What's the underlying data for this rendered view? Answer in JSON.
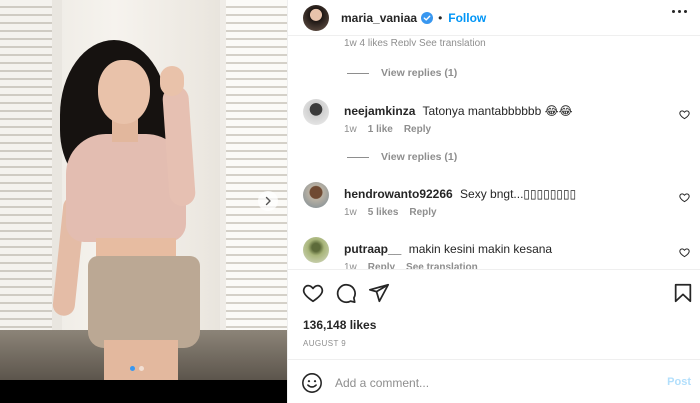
{
  "post": {
    "username": "maria_vaniaa",
    "separator": "•",
    "follow_label": "Follow",
    "carousel_dots": 2,
    "active_dot": 0
  },
  "comments": {
    "partial_line": "1w   4 likes   Reply   See translation",
    "view_replies_1": "View replies (1)",
    "view_replies_2": "View replies (1)",
    "items": [
      {
        "username": "neejamkinza",
        "text": "Tatonya mantabbbbbb 😂😂",
        "age": "1w",
        "likes": "1 like",
        "reply": "Reply"
      },
      {
        "username": "hendrowanto92266",
        "text": "Sexy bngt...▯▯▯▯▯▯▯▯",
        "age": "1w",
        "likes": "5 likes",
        "reply": "Reply"
      },
      {
        "username": "putraap__",
        "text": "makin kesini makin kesana",
        "age": "1w",
        "reply": "Reply",
        "translate": "See translation"
      }
    ]
  },
  "actions": {
    "icons": [
      "heart-icon",
      "comment-icon",
      "share-icon",
      "bookmark-icon"
    ],
    "likes_text": "136,148 likes",
    "date": "AUGUST 9"
  },
  "composer": {
    "placeholder": "Add a comment...",
    "post_label": "Post"
  },
  "colors": {
    "accent": "#0095f6",
    "post_disabled": "#b2dffc",
    "muted": "#8e8e8e",
    "text": "#262626"
  }
}
